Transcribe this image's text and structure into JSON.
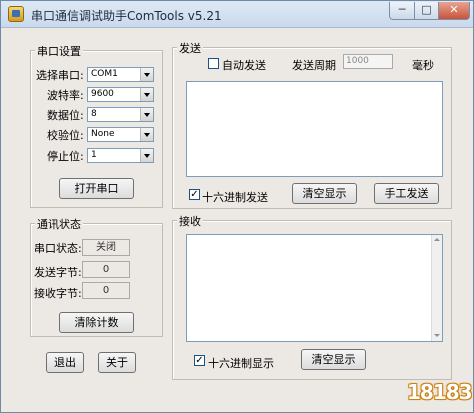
{
  "window": {
    "title": "串口通信调试助手ComTools v5.21",
    "min_label": "─",
    "max_label": "□",
    "close_label": "✕"
  },
  "serial_settings": {
    "group_title": "串口设置",
    "fields": [
      {
        "label": "选择串口:",
        "value": "COM1"
      },
      {
        "label": "波特率:",
        "value": "9600"
      },
      {
        "label": "数据位:",
        "value": "8"
      },
      {
        "label": "校验位:",
        "value": "None"
      },
      {
        "label": "停止位:",
        "value": "1"
      }
    ],
    "open_button": "打开串口"
  },
  "comm_status": {
    "group_title": "通讯状态",
    "port_status_label": "串口状态:",
    "port_status_value": "关闭",
    "sent_bytes_label": "发送字节:",
    "sent_bytes_value": "0",
    "recv_bytes_label": "接收字节:",
    "recv_bytes_value": "0",
    "clear_count_button": "清除计数"
  },
  "bottom_buttons": {
    "exit": "退出",
    "about": "关于"
  },
  "send": {
    "group_title": "发送",
    "auto_send_label": "自动发送",
    "auto_send_checked": false,
    "period_label": "发送周期",
    "period_value": "1000",
    "period_unit": "毫秒",
    "hex_send_label": "十六进制发送",
    "hex_send_checked": true,
    "checkmark": "✓",
    "clear_button": "清空显示",
    "manual_send_button": "手工发送"
  },
  "receive": {
    "group_title": "接收",
    "hex_display_label": "十六进制显示",
    "hex_display_checked": true,
    "checkmark": "✓",
    "clear_button": "清空显示"
  },
  "watermark": {
    "text": "18183"
  }
}
